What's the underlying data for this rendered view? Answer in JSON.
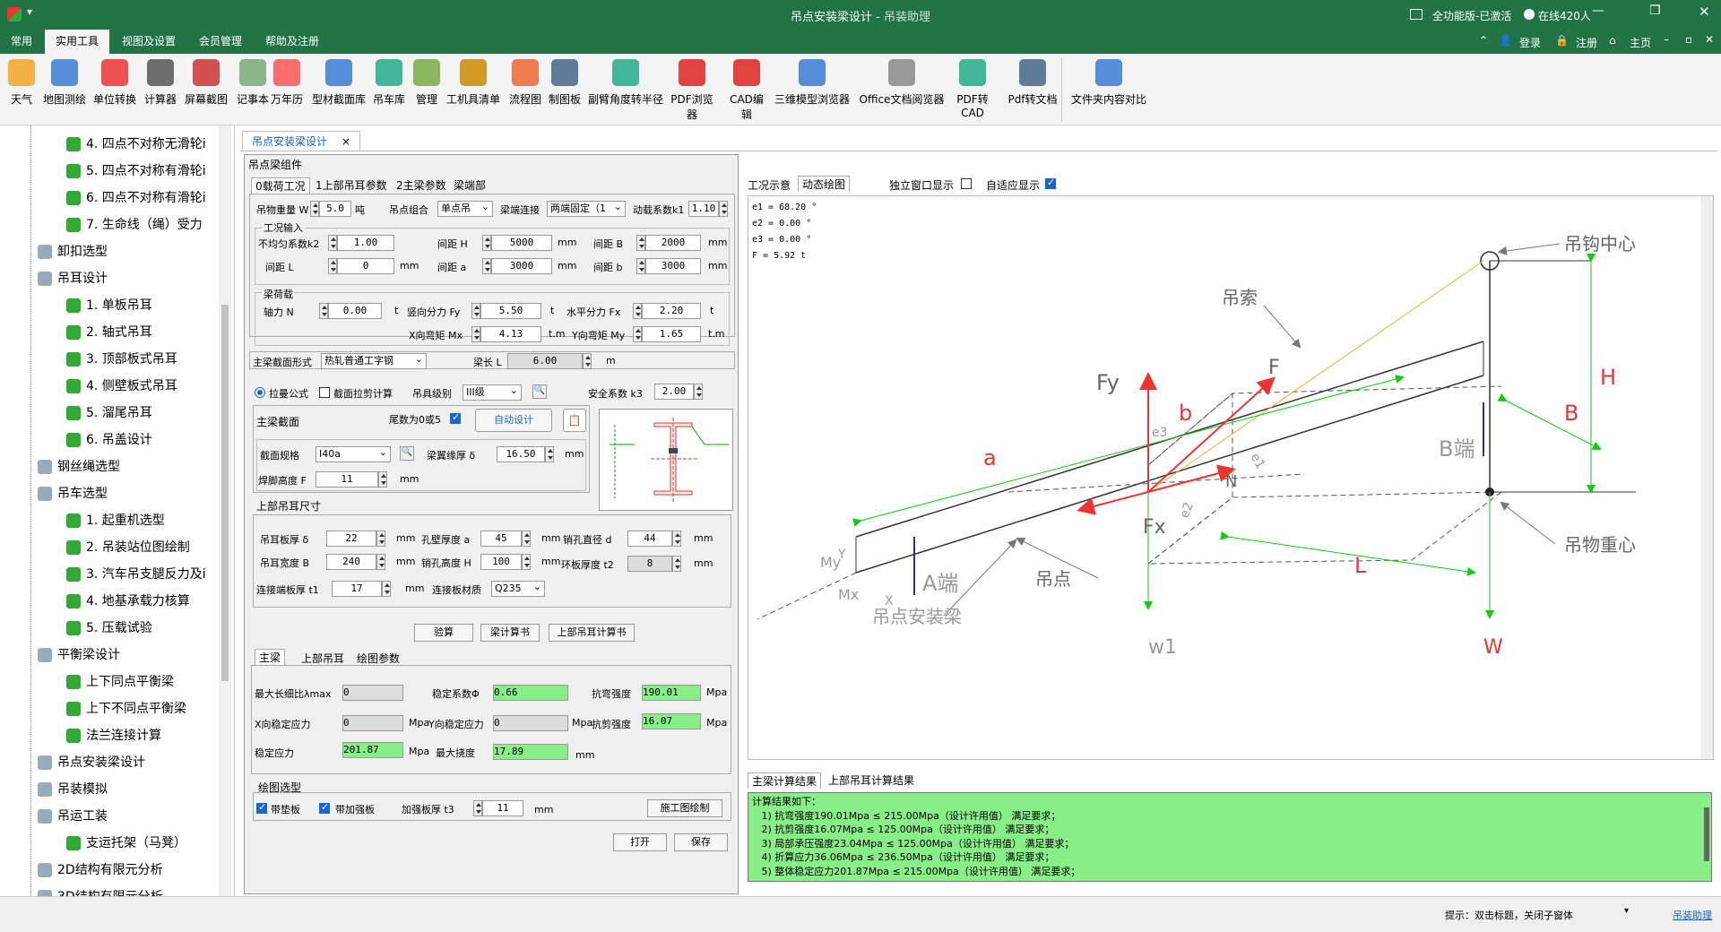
{
  "title": {
    "main": "吊点安装梁设计",
    "sep": " - ",
    "sub": "吊装助理"
  },
  "title_right": {
    "version": "全功能版-已激活",
    "online": "在线420人"
  },
  "menu": [
    "常用",
    "实用工具",
    "视图及设置",
    "会员管理",
    "帮助及注册"
  ],
  "menu_right": {
    "login": "登录",
    "register": "注册",
    "home": "主页"
  },
  "tools": [
    {
      "label": "天气",
      "icon": "weather-icon"
    },
    {
      "label": "地图测绘",
      "icon": "map-icon"
    },
    {
      "label": "单位转换",
      "icon": "unit-convert-icon"
    },
    {
      "label": "计算器",
      "icon": "calculator-icon"
    },
    {
      "label": "屏幕截图",
      "icon": "scissors-icon"
    },
    {
      "label": "记事本",
      "icon": "notepad-icon"
    },
    {
      "label": "万年历",
      "icon": "calendar-icon"
    },
    {
      "label": "型材截面库",
      "icon": "section-icon"
    },
    {
      "label": "吊车库",
      "icon": "crane-lib-icon"
    },
    {
      "label": "管理",
      "icon": "manage-icon"
    },
    {
      "label": "工机具清单",
      "icon": "clipboard-icon"
    },
    {
      "label": "流程图",
      "icon": "flowchart-icon"
    },
    {
      "label": "制图板",
      "icon": "drawing-board-icon"
    },
    {
      "label": "副臂角度转半径",
      "icon": "refresh-icon"
    },
    {
      "label": "PDF浏览器",
      "icon": "pdf-icon"
    },
    {
      "label": "CAD编辑",
      "icon": "cad-icon"
    },
    {
      "label": "三维模型浏览器",
      "icon": "globe-icon"
    },
    {
      "label": "Office文档阅览器",
      "icon": "document-icon"
    },
    {
      "label": "PDF转CAD",
      "icon": "convert-icon"
    },
    {
      "label": "Pdf转文档",
      "icon": "pdf-doc-icon"
    },
    {
      "label": "文件夹内容对比",
      "icon": "compare-icon"
    }
  ],
  "sidebar": [
    {
      "label": "4. 四点不对称无滑轮i",
      "level": 2
    },
    {
      "label": "5. 四点不对称有滑轮i",
      "level": 2
    },
    {
      "label": "6. 四点不对称有滑轮i",
      "level": 2
    },
    {
      "label": "7. 生命线（绳）受力",
      "level": 2
    },
    {
      "label": "卸扣选型",
      "level": 1
    },
    {
      "label": "吊耳设计",
      "level": 1
    },
    {
      "label": "1. 单板吊耳",
      "level": 2
    },
    {
      "label": "2. 轴式吊耳",
      "level": 2
    },
    {
      "label": "3. 顶部板式吊耳",
      "level": 2
    },
    {
      "label": "4. 侧壁板式吊耳",
      "level": 2
    },
    {
      "label": "5. 溜尾吊耳",
      "level": 2
    },
    {
      "label": "6. 吊盖设计",
      "level": 2
    },
    {
      "label": "钢丝绳选型",
      "level": 1
    },
    {
      "label": "吊车选型",
      "level": 1
    },
    {
      "label": "1. 起重机选型",
      "level": 2
    },
    {
      "label": "2. 吊装站位图绘制",
      "level": 2
    },
    {
      "label": "3. 汽车吊支腿反力及i",
      "level": 2
    },
    {
      "label": "4. 地基承载力核算",
      "level": 2
    },
    {
      "label": "5. 压载试验",
      "level": 2
    },
    {
      "label": "平衡梁设计",
      "level": 1
    },
    {
      "label": "上下同点平衡梁",
      "level": 2
    },
    {
      "label": "上下不同点平衡梁",
      "level": 2
    },
    {
      "label": "法兰连接计算",
      "level": 2
    },
    {
      "label": "吊点安装梁设计",
      "level": 1
    },
    {
      "label": "吊装模拟",
      "level": 1
    },
    {
      "label": "吊运工装",
      "level": 1
    },
    {
      "label": "支运托架（马凳）",
      "level": 2
    },
    {
      "label": "2D结构有限元分析",
      "level": 1
    },
    {
      "label": "3D结构有限元分析",
      "level": 1
    }
  ],
  "doc_tab": "吊点安装梁设计",
  "group_title": "吊点梁组件",
  "tabs_top": [
    "0载荷工况",
    "1上部吊耳参数",
    "2主梁参数",
    "梁端部"
  ],
  "load": {
    "weight_label": "吊物重量 W",
    "weight": "5.0",
    "weight_unit": "吨",
    "combo_label": "吊点组合",
    "combo": "单点吊",
    "conn_label": "梁端连接",
    "conn": "两端固定（1",
    "dyn_label": "动载系数k1",
    "dyn": "1.10"
  },
  "cond": {
    "title": "工况输入",
    "k2_label": "不均匀系数k2",
    "k2": "1.00",
    "H_label": "间距 H",
    "H": "5000",
    "B_label": "间距 B",
    "B": "2000",
    "L_label": "间距 L",
    "L": "0",
    "a_label": "间距 a",
    "a": "3000",
    "b_label": "间距 b",
    "b": "3000",
    "mm": "mm"
  },
  "beam_load": {
    "title": "梁荷载",
    "N_label": "轴力 N",
    "N": "0.00",
    "Fy_label": "竖向分力 Fy",
    "Fy": "5.50",
    "Fx_label": "水平分力 Fx",
    "Fx": "2.20",
    "Mx_label": "X向弯矩 Mx",
    "Mx": "4.13",
    "My_label": "Y向弯矩 My",
    "My": "1.65",
    "t": "t",
    "tm": "t.m"
  },
  "section": {
    "form_label": "主梁截面形式",
    "form": "热轧普通工字钢",
    "len_label": "梁长 L",
    "len": "6.00",
    "len_unit": "m"
  },
  "opts": {
    "r1": "拉曼公式",
    "c1": "截面拉剪计算",
    "grade_label": "吊具级别",
    "grade": "III级",
    "safe_label": "安全系数 k3",
    "safe": "2.00"
  },
  "main_sec": {
    "title": "主梁截面",
    "tail_label": "尾数为0或5",
    "auto": "自动设计",
    "spec_label": "截面规格",
    "spec": "I40a",
    "flange_label": "梁翼缘厚 δ",
    "flange": "16.50",
    "weld_label": "焊脚高度 F",
    "weld": "11",
    "mm": "mm"
  },
  "lug": {
    "title": "上部吊耳尺寸",
    "t_label": "吊耳板厚 δ",
    "t": "22",
    "wall_label": "孔壁厚度 a",
    "wall": "45",
    "pin_label": "销孔直径 d",
    "pin": "44",
    "w_label": "吊耳宽度 B",
    "w": "240",
    "hole_label": "销孔高度 H",
    "hole": "100",
    "ring_label": "环板厚度 t2",
    "ring": "8",
    "c_label": "连接端板厚 t1",
    "c": "17",
    "mat_label": "连接板材质",
    "mat": "Q235",
    "mm": "mm"
  },
  "btns": {
    "check": "验算",
    "beam_book": "梁计算书",
    "lug_book": "上部吊耳计算书",
    "draw": "施工图绘制",
    "open": "打开",
    "save": "保存"
  },
  "tabs_mid": [
    "主梁",
    "上部吊耳",
    "绘图参数"
  ],
  "results": {
    "slender_label": "最大长细比λmax",
    "slender": "0",
    "stab_label": "稳定系数Φ",
    "stab": "0.66",
    "bend_label": "抗弯强度",
    "bend": "190.01",
    "xstab_label": "X向稳定应力",
    "xstab": "0",
    "ystab_label": "Y向稳定应力",
    "ystab": "0",
    "shear_label": "抗剪强度",
    "shear": "16.07",
    "st_label": "稳定应力",
    "st": "201.87",
    "defl_label": "最大挠度",
    "defl": "17.89",
    "mpa": "Mpa",
    "mm": "mm"
  },
  "draw_sel": {
    "title": "绘图选型",
    "pad": "带垫板",
    "rib": "带加强板",
    "rib_t_label": "加强板厚 t3",
    "rib_t": "11",
    "mm": "mm"
  },
  "right_tabs": [
    "工况示意",
    "动态绘图"
  ],
  "right_opts": {
    "solo": "独立窗口显示",
    "fit": "自适应显示"
  },
  "diagram_info": [
    "e1 = 68.20 °",
    "e2 = 0.00 °",
    "e3 = 0.00 °",
    "F = 5.92 t"
  ],
  "diagram_labels": {
    "hook": "吊钩中心",
    "rope": "吊索",
    "F": "F",
    "Fy": "Fy",
    "b": "b",
    "a": "a",
    "B": "B",
    "Bend": "B端",
    "H": "H",
    "N": "N",
    "Fx": "Fx",
    "L": "L",
    "cg": "吊物重心",
    "point": "吊点",
    "W": "W",
    "W1": "w1",
    "Aend": "A端",
    "beam": "吊点安装梁",
    "My": "My",
    "Mx": "Mx",
    "X": "X",
    "Y": "Y",
    "e1": "e1",
    "e2": "e2",
    "e3": "e3"
  },
  "result_tabs": [
    "主梁计算结果",
    "上部吊耳计算结果"
  ],
  "result_lines": [
    "计算结果如下：",
    "   1) 抗弯强度190.01Mpa ≤ 215.00Mpa（设计许用值） 满足要求；",
    "   2) 抗剪强度16.07Mpa ≤ 125.00Mpa（设计许用值） 满足要求；",
    "   3) 局部承压强度23.04Mpa ≤ 125.00Mpa（设计许用值） 满足要求；",
    "   4) 折算应力36.06Mpa ≤ 236.50Mpa（设计许用值） 满足要求；",
    "   5) 整体稳定应力201.87Mpa ≤ 215.00Mpa（设计许用值） 满足要求；"
  ],
  "status": {
    "hint": "提示：双击标题，关闭子窗体",
    "link": "吊装助理"
  },
  "colors": {
    "brand": "#217346",
    "green_field": "#88ee88"
  }
}
